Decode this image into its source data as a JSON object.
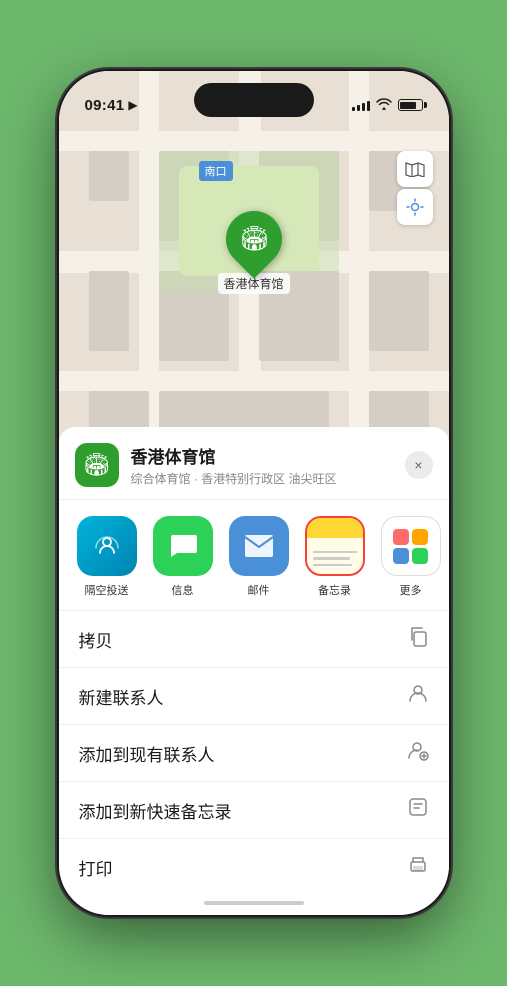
{
  "status_bar": {
    "time": "09:41",
    "location_arrow": "▶"
  },
  "map": {
    "exit_label": "南口",
    "pin_label": "香港体育馆",
    "controls": {
      "map_icon": "🗺",
      "location_icon": "↗"
    }
  },
  "location_card": {
    "name": "香港体育馆",
    "subtitle": "综合体育馆 · 香港特别行政区 油尖旺区",
    "close_label": "×"
  },
  "share_items": [
    {
      "id": "airdrop",
      "label": "隔空投送",
      "icon_type": "airdrop"
    },
    {
      "id": "message",
      "label": "信息",
      "icon_type": "message"
    },
    {
      "id": "mail",
      "label": "邮件",
      "icon_type": "mail"
    },
    {
      "id": "notes",
      "label": "备忘录",
      "icon_type": "notes"
    },
    {
      "id": "more",
      "label": "更多",
      "icon_type": "more"
    }
  ],
  "action_rows": [
    {
      "id": "copy",
      "label": "拷贝",
      "icon": "📋"
    },
    {
      "id": "new-contact",
      "label": "新建联系人",
      "icon": "👤"
    },
    {
      "id": "add-existing",
      "label": "添加到现有联系人",
      "icon": "👤"
    },
    {
      "id": "add-notes",
      "label": "添加到新快速备忘录",
      "icon": "📝"
    },
    {
      "id": "print",
      "label": "打印",
      "icon": "🖨"
    }
  ]
}
